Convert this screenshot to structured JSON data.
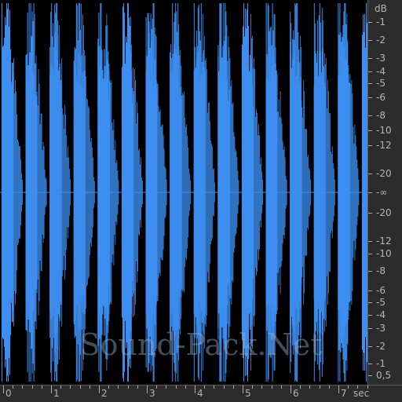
{
  "waveform": {
    "bursts": 16,
    "duration_sec": 7.6,
    "color": "#3d8ef0",
    "background": "#000000"
  },
  "db_scale": {
    "unit": "dB",
    "labels": [
      "-1",
      "-2",
      "-3",
      "-4",
      "-5",
      "-6",
      "-8",
      "-10",
      "-12",
      "-20",
      "-∞",
      "-20",
      "-12",
      "-10",
      "-8",
      "-6",
      "-5",
      "-4",
      "-3",
      "-2",
      "-1",
      "0,5"
    ]
  },
  "time_ruler": {
    "unit": "sec",
    "labels": [
      "0",
      "1",
      "2",
      "3",
      "4",
      "5",
      "6",
      "7"
    ]
  },
  "watermark": "Sound-Pack.Net"
}
